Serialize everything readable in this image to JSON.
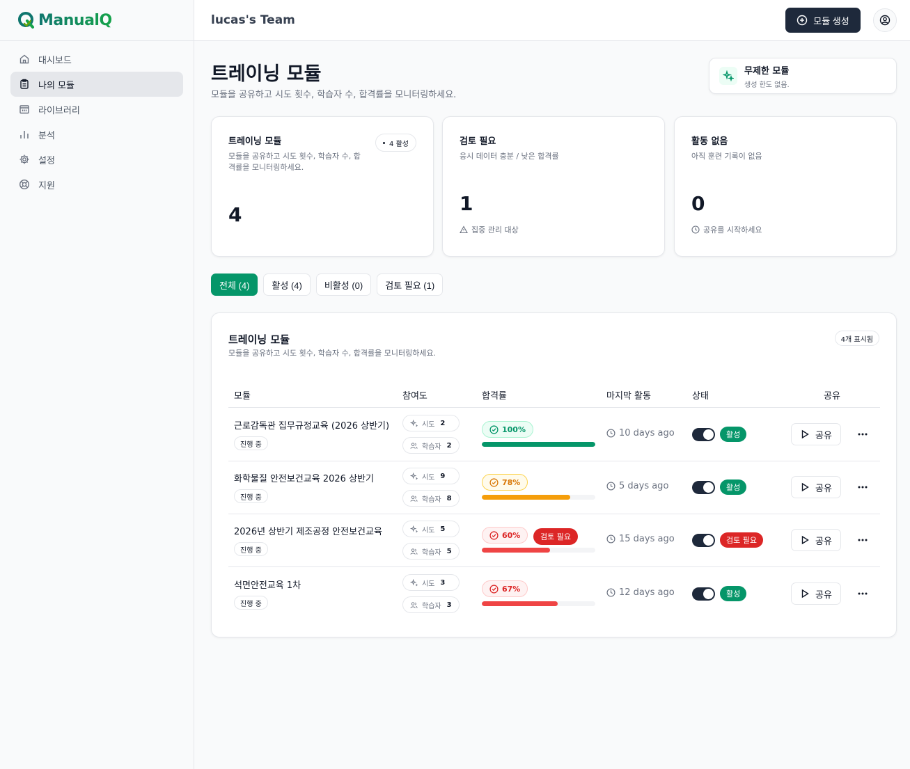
{
  "brand": {
    "logo_text": "ManualQ"
  },
  "sidebar": {
    "items": [
      {
        "label": "대시보드",
        "icon": "home-icon"
      },
      {
        "label": "나의 모듈",
        "icon": "clipboard-icon"
      },
      {
        "label": "라이브러리",
        "icon": "library-icon"
      },
      {
        "label": "분석",
        "icon": "bar-chart-icon"
      },
      {
        "label": "설정",
        "icon": "gear-icon"
      },
      {
        "label": "지원",
        "icon": "lifebuoy-icon"
      }
    ]
  },
  "topbar": {
    "team": "lucas's Team",
    "create_label": "모듈 생성"
  },
  "page": {
    "title": "트레이닝 모듈",
    "subtitle": "모듈을 공유하고 시도 횟수, 학습자 수, 합격률을 모니터링하세요."
  },
  "unlimited": {
    "title": "무제한 모듈",
    "subtitle": "생성 한도 없음."
  },
  "stats": {
    "modules": {
      "title": "트레이닝 모듈",
      "desc": "모듈을 공유하고 시도 횟수, 학습자 수, 합격률을 모니터링하세요.",
      "value": "4",
      "badge": "4 활성"
    },
    "review": {
      "title": "검토 필요",
      "desc": "응시 데이터 충분 / 낮은 합격률",
      "value": "1",
      "foot": "집중 관리 대상"
    },
    "inactive": {
      "title": "활동 없음",
      "desc": "아직 훈련 기록이 없음",
      "value": "0",
      "foot": "공유를 시작하세요"
    }
  },
  "filters": [
    "전체 (4)",
    "활성 (4)",
    "비활성 (0)",
    "검토 필요 (1)"
  ],
  "table": {
    "title": "트레이닝 모듈",
    "subtitle": "모듈을 공유하고 시도 횟수, 학습자 수, 합격률을 모니터링하세요.",
    "count_badge": "4개 표시됨",
    "headers": {
      "module": "모듈",
      "engagement": "참여도",
      "pass_rate": "합격률",
      "last_activity": "마지막 활동",
      "status": "상태",
      "share": "공유"
    },
    "attempts_label": "시도",
    "learners_label": "학습자",
    "share_label": "공유",
    "rows": [
      {
        "name": "근로감독관 집무규정교육 (2026 상반기)",
        "progress": "진행 중",
        "attempts": "2",
        "learners": "2",
        "rate": "100%",
        "rate_value": 100,
        "rate_tone": "g",
        "bar_color": "#059669",
        "review": "",
        "last": "10 days ago",
        "status": "활성",
        "status_color": "#059669"
      },
      {
        "name": "화학물질 안전보건교육 2026 상반기",
        "progress": "진행 중",
        "attempts": "9",
        "learners": "8",
        "rate": "78%",
        "rate_value": 78,
        "rate_tone": "y",
        "bar_color": "#f59e0b",
        "review": "",
        "last": "5 days ago",
        "status": "활성",
        "status_color": "#059669"
      },
      {
        "name": "2026년 상반기 제조공정 안전보건교육",
        "progress": "진행 중",
        "attempts": "5",
        "learners": "5",
        "rate": "60%",
        "rate_value": 60,
        "rate_tone": "r",
        "bar_color": "#ef4444",
        "review": "검토 필요",
        "last": "15 days ago",
        "status": "검토 필요",
        "status_color": "#dc2626"
      },
      {
        "name": "석면안전교육 1차",
        "progress": "진행 중",
        "attempts": "3",
        "learners": "3",
        "rate": "67%",
        "rate_value": 67,
        "rate_tone": "r",
        "bar_color": "#ef4444",
        "review": "",
        "last": "12 days ago",
        "status": "활성",
        "status_color": "#059669"
      }
    ]
  }
}
